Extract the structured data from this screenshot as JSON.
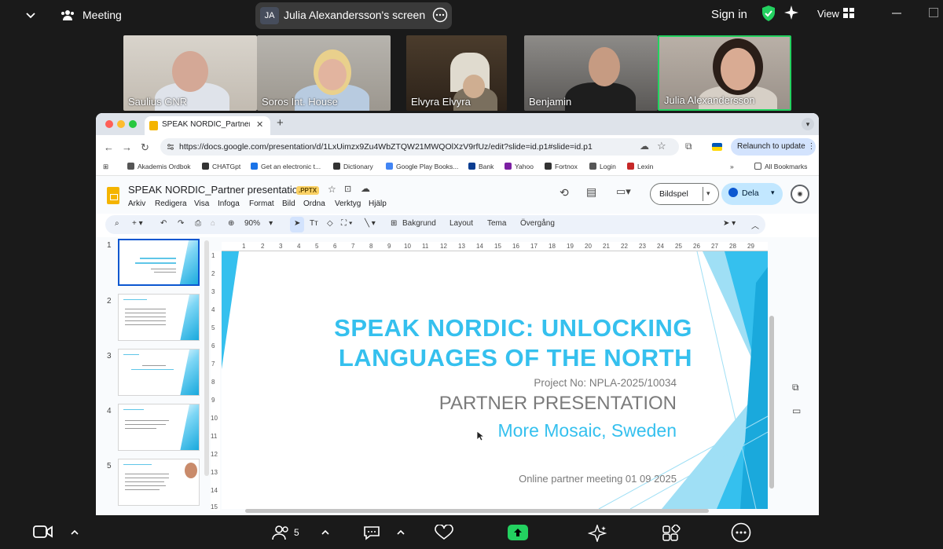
{
  "topbar": {
    "meeting_label": "Meeting",
    "screen_initials": "JA",
    "screen_title": "Julia Alexandersson's screen",
    "sign_in": "Sign in",
    "view_label": "View"
  },
  "participants": [
    {
      "name": "Saulius GNR"
    },
    {
      "name": "Soros Int. House"
    },
    {
      "name": "Elvyra Elvyra"
    },
    {
      "name": "Benjamin"
    },
    {
      "name": "Julia Alexandersson",
      "active": true
    }
  ],
  "browser": {
    "tab_title": "SPEAK NORDIC_Partner pres",
    "url": "https://docs.google.com/presentation/d/1LxUimzx9Zu4WbZTQW21MWQOlXzV9rfUz/edit?slide=id.p1#slide=id.p1",
    "relaunch": "Relaunch to update",
    "bookmarks": [
      {
        "label": "Akademis Ordbok",
        "color": "#555"
      },
      {
        "label": "CHATGpt",
        "color": "#333"
      },
      {
        "label": "Get an electronic t...",
        "color": "#1a73e8"
      },
      {
        "label": "Dictionary",
        "color": "#333"
      },
      {
        "label": "Google Play Books...",
        "color": "#4285f4"
      },
      {
        "label": "Bank",
        "color": "#0b3d91"
      },
      {
        "label": "Yahoo",
        "color": "#7b1fa2"
      },
      {
        "label": "Fortnox",
        "color": "#333"
      },
      {
        "label": "Login",
        "color": "#555"
      },
      {
        "label": "Lexin",
        "color": "#c62828"
      }
    ],
    "all_bookmarks": "All Bookmarks"
  },
  "slides_app": {
    "doc_title": "SPEAK NORDIC_Partner presentation",
    "file_badge": ".PPTX",
    "menus": [
      "Arkiv",
      "Redigera",
      "Visa",
      "Infoga",
      "Format",
      "Bild",
      "Ordna",
      "Verktyg",
      "Hjälp"
    ],
    "bildspel": "Bildspel",
    "dela": "Dela",
    "zoom": "90%",
    "toolbar_labels": [
      "Bakgrund",
      "Layout",
      "Tema",
      "Övergång"
    ],
    "thumbnail_numbers": [
      "1",
      "2",
      "3",
      "4",
      "5"
    ]
  },
  "slide": {
    "title_line1": "SPEAK NORDIC: UNLOCKING",
    "title_line2": "LANGUAGES OF THE NORTH",
    "project_no": "Project No: NPLA-2025/10034",
    "subtitle": "PARTNER PRESENTATION",
    "org": "More Mosaic, Sweden",
    "meeting": "Online partner meeting 01 09 2025"
  },
  "bottombar": {
    "participants_count": "5"
  },
  "colors": {
    "accent_blue": "#35c0ee",
    "active_border": "#23d160",
    "share_green": "#23d160"
  }
}
